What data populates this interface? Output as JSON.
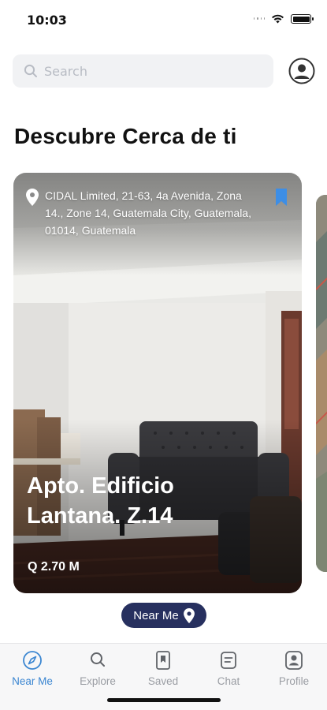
{
  "status_bar": {
    "time": "10:03"
  },
  "search": {
    "placeholder": "Search",
    "value": ""
  },
  "page": {
    "title": "Descubre Cerca de ti"
  },
  "listing": {
    "address": "CIDAL Limited, 21-63, 4a Avenida, Zona 14., Zone 14, Guatemala City, Guatemala, 01014, Guatemala",
    "title": "Apto. Edificio Lantana. Z.14",
    "price": "Q 2.70 M",
    "bookmarked": true
  },
  "near_me_button": {
    "label": "Near Me"
  },
  "tabs": [
    {
      "label": "Near Me",
      "icon": "compass-icon",
      "active": true
    },
    {
      "label": "Explore",
      "icon": "search-icon",
      "active": false
    },
    {
      "label": "Saved",
      "icon": "bookmark-icon",
      "active": false
    },
    {
      "label": "Chat",
      "icon": "chat-icon",
      "active": false
    },
    {
      "label": "Profile",
      "icon": "profile-icon",
      "active": false
    }
  ],
  "colors": {
    "accent": "#3b86d1",
    "pill": "#27305f",
    "bookmark": "#3d8ee6",
    "tab_inactive": "#9a9da3"
  }
}
